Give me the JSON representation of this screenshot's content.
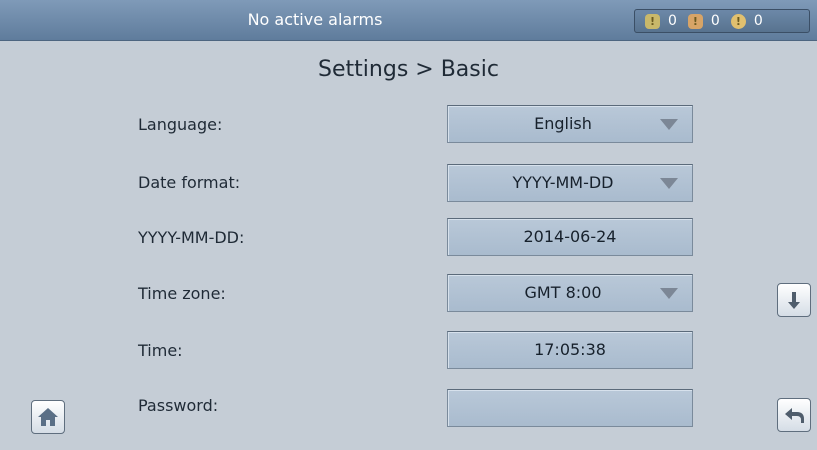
{
  "status_bar": {
    "alarm_text": "No active alarms",
    "counts": {
      "warning": "0",
      "minor": "0",
      "major": "0"
    },
    "icons": [
      "warning-alarm-icon",
      "minor-alarm-icon",
      "major-alarm-icon"
    ]
  },
  "page": {
    "title": "Settings > Basic"
  },
  "settings": {
    "language": {
      "label": "Language:",
      "value": "English"
    },
    "date_format": {
      "label": "Date format:",
      "value": "YYYY-MM-DD"
    },
    "date": {
      "label": "YYYY-MM-DD:",
      "value": "2014-06-24"
    },
    "time_zone": {
      "label": "Time zone:",
      "value": "GMT 8:00"
    },
    "time": {
      "label": "Time:",
      "value": "17:05:38"
    },
    "password": {
      "label": "Password:",
      "value": ""
    }
  },
  "nav": {
    "home_icon": "home-icon",
    "scroll_down_icon": "arrow-down-icon",
    "back_icon": "back-arrow-icon"
  },
  "colors": {
    "background": "#c5cdd6",
    "status_bar": "#6f8bab",
    "field": "#b0c1d3"
  }
}
